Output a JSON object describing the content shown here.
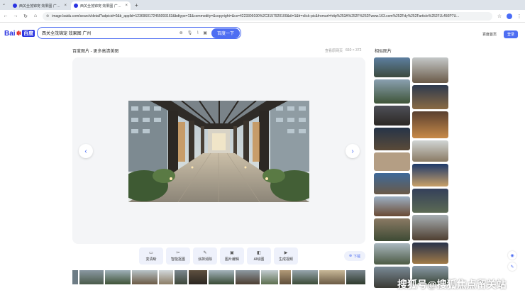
{
  "browser": {
    "tabs": [
      {
        "title": "西关全茂锦宠 效果图 广州_百",
        "active": false
      },
      {
        "title": "西关全茂锦宠 效果图 广州的",
        "active": true
      }
    ],
    "new_tab": "+",
    "url": "image.baidu.com/search/detail?adpicid=0&b_applid=1236960172455093163&bdtype=11&commodity=&copyright=&cs=4223309190%2C3157920100&di=1&fr=click-pic&fromurl=http%253A%252F%252Fwww.163.com%252Fdy%252Farticle%252FJL450P7U..."
  },
  "header": {
    "logo_text": "Bai",
    "logo_cn": "百度",
    "search_value": "西关全茂锦宠 效果图 广州",
    "search_button": "百度一下",
    "home_link": "百度首页",
    "login": "登录"
  },
  "main": {
    "breadcrumb": "百度图片 - 更多高清美图",
    "view_source": "查看原网页",
    "dimensions": "660 × 372",
    "tools": [
      {
        "icon": "hd-icon",
        "glyph": "▭",
        "label": "变清晰"
      },
      {
        "icon": "smart-crop-icon",
        "glyph": "✂",
        "label": "智能抠图"
      },
      {
        "icon": "eraser-icon",
        "glyph": "✎",
        "label": "涂抹消除"
      },
      {
        "icon": "image-edit-icon",
        "glyph": "▣",
        "label": "图片编辑"
      },
      {
        "icon": "ai-image-icon",
        "glyph": "◧",
        "label": "AI绘图"
      },
      {
        "icon": "video-icon",
        "glyph": "▶",
        "label": "生成视频"
      }
    ],
    "download": "下载"
  },
  "similar": {
    "title": "相似图片"
  },
  "watermark": "搜狐号@搜狐焦点留关站",
  "colors": {
    "accent": "#4e6ef2",
    "brand_blue": "#2932e1",
    "brand_red": "#e10601"
  }
}
